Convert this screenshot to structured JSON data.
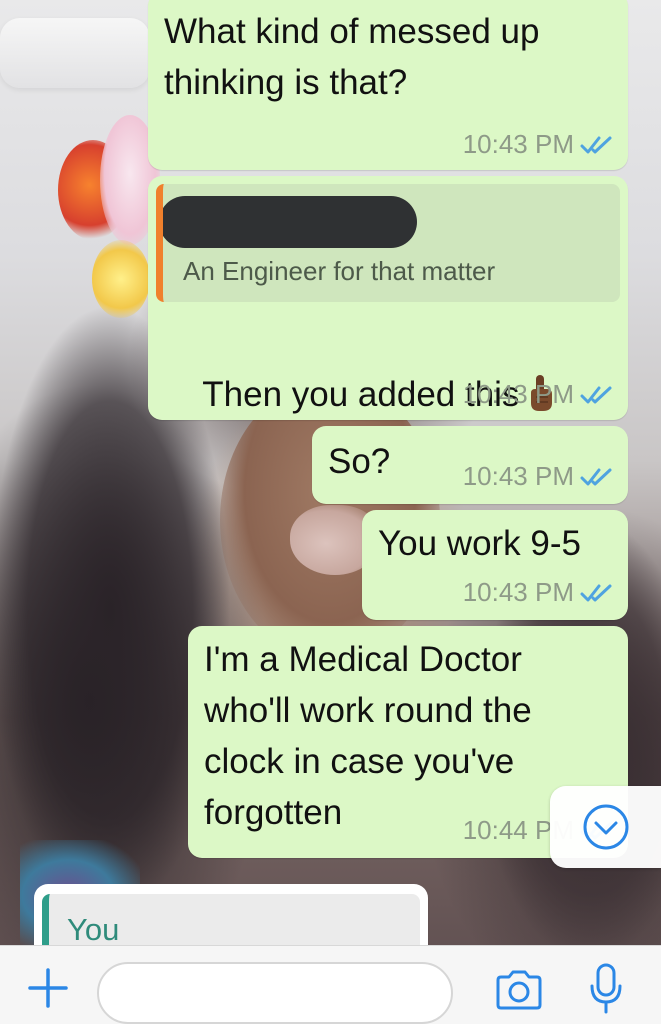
{
  "messages": [
    {
      "text": "What kind of messed up\nthinking is that?",
      "time": "10:43 PM",
      "status": "read"
    },
    {
      "quote": {
        "author_redacted": true,
        "text": "An Engineer for that matter",
        "accent": "#f0802c"
      },
      "text": "Then you added this",
      "emoji": "pointing-up-hand",
      "time": "10:43 PM",
      "status": "read"
    },
    {
      "text": "So?",
      "time": "10:43 PM",
      "status": "read"
    },
    {
      "text": "You work 9-5",
      "time": "10:43 PM",
      "status": "read"
    },
    {
      "text": "I'm a Medical Doctor\nwho'll work round the\nclock in case you've\nforgotten",
      "time": "10:44 PM",
      "status": "read"
    }
  ],
  "reply_preview": {
    "name": "You",
    "accent": "#2f9e8a"
  },
  "scroll_button": {
    "icon": "chevron-down-circle-icon"
  },
  "input_bar": {
    "placeholder": "",
    "value": "",
    "icons": [
      "plus-icon",
      "camera-icon",
      "microphone-icon"
    ]
  },
  "colors": {
    "outgoing_bubble": "#dcf8c6",
    "read_ticks": "#4fa3e0",
    "ios_blue": "#2b87e6"
  }
}
